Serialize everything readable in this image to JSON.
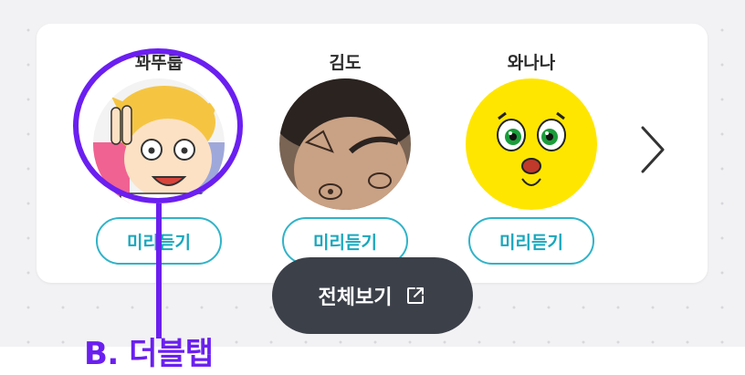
{
  "creators": [
    {
      "name": "꽈뚜룹",
      "avatar_icon": "cartoon-blond-boy-peace-sign-avatar",
      "preview_label": "미리듣기"
    },
    {
      "name": "김도",
      "avatar_icon": "person-face-with-doodles-avatar",
      "preview_label": "미리듣기"
    },
    {
      "name": "와나나",
      "avatar_icon": "yellow-cartoon-creature-avatar",
      "preview_label": "미리듣기"
    }
  ],
  "next_icon": "chevron-right-icon",
  "view_all": {
    "label": "전체보기",
    "icon": "external-link-icon"
  },
  "annotation": {
    "label": "B. 더블탭"
  },
  "colors": {
    "accent": "#6b1ff0",
    "preview_border": "#30b3c8",
    "preview_text": "#19a7bd",
    "view_all_bg": "#3c4049"
  }
}
